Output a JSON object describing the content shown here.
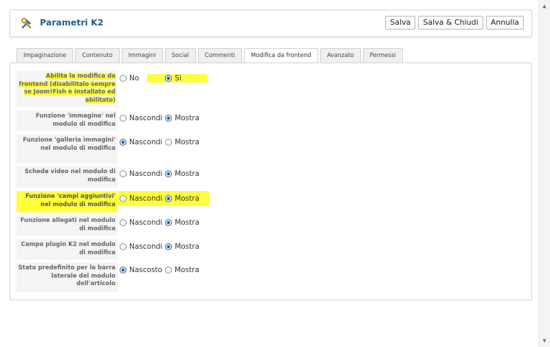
{
  "header": {
    "title": "Parametri K2",
    "icon": "tools-icon"
  },
  "toolbar": {
    "save": "Salva",
    "save_close": "Salva & Chiudi",
    "cancel": "Annulla"
  },
  "tabs": [
    {
      "label": "Impaginazione",
      "active": false
    },
    {
      "label": "Contenuto",
      "active": false
    },
    {
      "label": "Immagini",
      "active": false
    },
    {
      "label": "Social",
      "active": false
    },
    {
      "label": "Commenti",
      "active": false
    },
    {
      "label": "Modifica da frontend",
      "active": true
    },
    {
      "label": "Avanzato",
      "active": false
    },
    {
      "label": "Permessi",
      "active": false
    }
  ],
  "settings": [
    {
      "label": "Abilita la modifica da frontend (disabilitalo sempre se Joom!Fish è installato ed abilitato)",
      "options": [
        {
          "label": "No",
          "checked": false
        },
        {
          "label": "Sì",
          "checked": true
        }
      ],
      "highlighted": true
    },
    {
      "label": "Funzione 'immagine' nel modulo di modifica",
      "options": [
        {
          "label": "Nascondi",
          "checked": false
        },
        {
          "label": "Mostra",
          "checked": true
        }
      ],
      "highlighted": false
    },
    {
      "label": "Funzione 'galleria immagini' nel modulo di modifica",
      "options": [
        {
          "label": "Nascondi",
          "checked": true
        },
        {
          "label": "Mostra",
          "checked": false
        }
      ],
      "highlighted": false
    },
    {
      "label": "Scheda video nel modulo di modifica",
      "options": [
        {
          "label": "Nascondi",
          "checked": false
        },
        {
          "label": "Mostra",
          "checked": true
        }
      ],
      "highlighted": false
    },
    {
      "label": "Funzione 'campi aggiuntivi' nel modulo di modifica",
      "options": [
        {
          "label": "Nascondi",
          "checked": false
        },
        {
          "label": "Mostra",
          "checked": true
        }
      ],
      "highlighted": true
    },
    {
      "label": "Funzione allegati nel modulo di modifica",
      "options": [
        {
          "label": "Nascondi",
          "checked": false
        },
        {
          "label": "Mostra",
          "checked": true
        }
      ],
      "highlighted": false
    },
    {
      "label": "Campo plugin K2 nel modulo di modifica",
      "options": [
        {
          "label": "Nascondi",
          "checked": false
        },
        {
          "label": "Mostra",
          "checked": true
        }
      ],
      "highlighted": false
    },
    {
      "label": "Stato predefinito per la barra laterale del modulo dell'articolo",
      "options": [
        {
          "label": "Nascosto",
          "checked": true
        },
        {
          "label": "Mostra",
          "checked": false
        }
      ],
      "highlighted": false
    }
  ],
  "colors": {
    "accent": "#1f5c91",
    "highlight": "#ffff3a"
  }
}
